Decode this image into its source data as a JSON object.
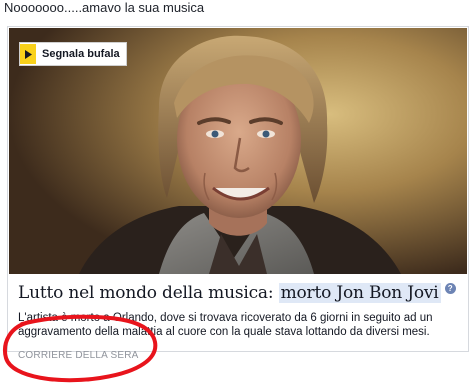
{
  "post": {
    "text": "Nooooooo.....amavo la sua musica"
  },
  "card": {
    "badge_label": "Segnala bufala",
    "headline_prefix": "Lutto nel mondo della musica: ",
    "headline_highlight": "morto Jon Bon Jovi",
    "info_icon_glyph": "?",
    "description": "L'artista è morto a Orlando, dove si trovava ricoverato da 6 giorni in seguito ad un aggravamento della malattia al cuore con la quale stava lottando da diversi mesi.",
    "source": "CORRIERE DELLA SERA"
  },
  "colors": {
    "badge_accent": "#f9d11b",
    "highlight": "#dfe8f6",
    "annotation": "#e8141c",
    "source_text": "#90949c"
  },
  "icons": {
    "badge_icon": "play-arrow-icon",
    "info_icon": "question-mark-icon"
  }
}
